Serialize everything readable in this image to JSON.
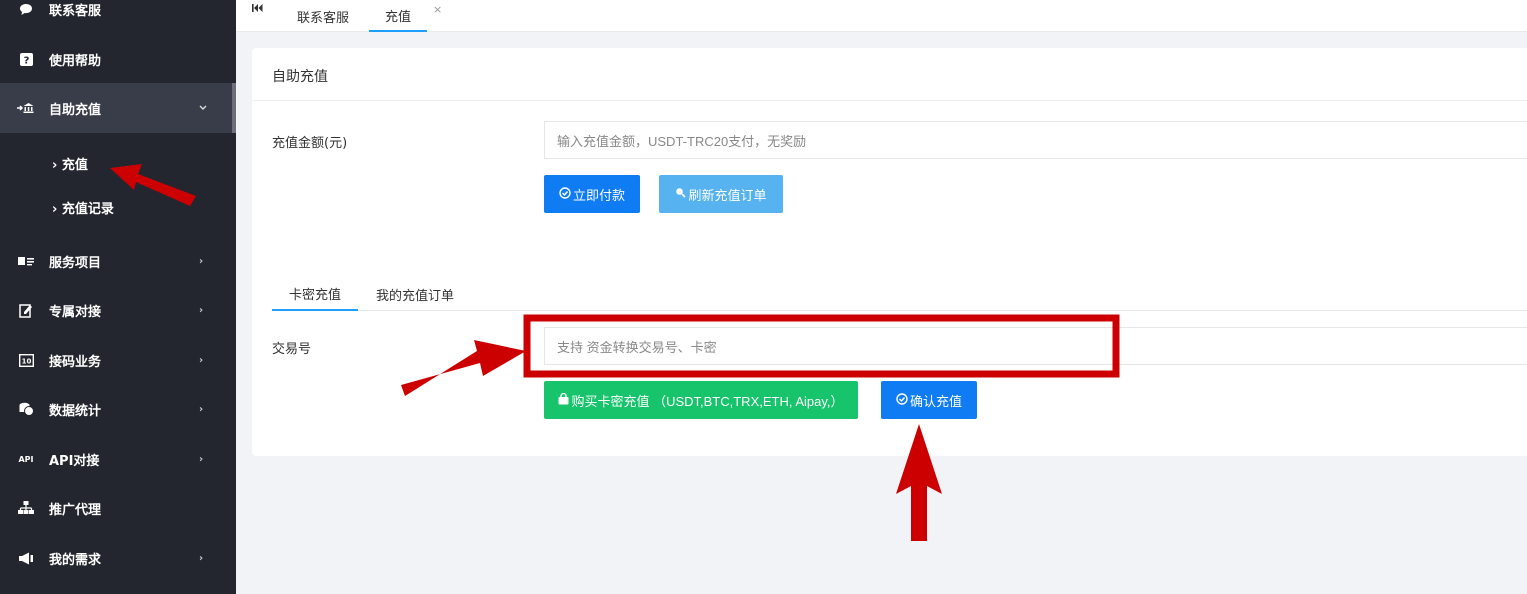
{
  "sidebar": {
    "items": [
      {
        "label": "联系客服",
        "icon": "chat-icon"
      },
      {
        "label": "使用帮助",
        "icon": "help-icon"
      },
      {
        "label": "自助充值",
        "icon": "bank-icon"
      },
      {
        "label": "服务项目",
        "icon": "card-icon"
      },
      {
        "label": "专属对接",
        "icon": "edit-icon"
      },
      {
        "label": "接码业务",
        "icon": "code-icon"
      },
      {
        "label": "数据统计",
        "icon": "coins-icon"
      },
      {
        "label": "API对接",
        "icon": "api-icon"
      },
      {
        "label": "推广代理",
        "icon": "sitemap-icon"
      },
      {
        "label": "我的需求",
        "icon": "bullhorn-icon"
      }
    ],
    "sub_items": [
      {
        "label": "充值"
      },
      {
        "label": "充值记录"
      }
    ]
  },
  "tabbar": {
    "tabs": [
      {
        "label": "联系客服"
      },
      {
        "label": "充值"
      }
    ],
    "close_glyph": "×"
  },
  "card": {
    "title": "自助充值",
    "amount_label": "充值金额(元)",
    "amount_placeholder": "输入充值金额，USDT-TRC20支付，无奖励",
    "pay_button": "立即付款",
    "refresh_button": "刷新充值订单",
    "tabs": [
      {
        "label": "卡密充值"
      },
      {
        "label": "我的充值订单"
      }
    ],
    "txn_label": "交易号",
    "txn_placeholder": "支持 资金转换交易号、卡密",
    "buy_button": "购买卡密充值 （USDT,BTC,TRX,ETH, Aipay,）",
    "confirm_button": "确认充值"
  },
  "colors": {
    "sidebar_bg": "#23262e",
    "accent_blue": "#0f7cf4",
    "light_blue": "#56b3f0",
    "green": "#17c46b",
    "annotation_red": "#cc0000"
  }
}
